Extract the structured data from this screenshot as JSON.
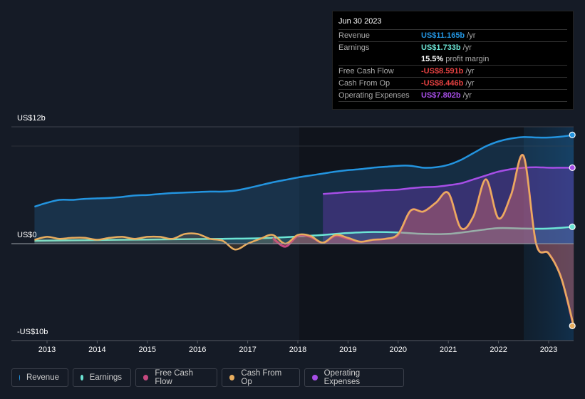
{
  "tooltip": {
    "date": "Jun 30 2023",
    "rows": [
      {
        "label": "Revenue",
        "value": "US$11.165b",
        "unit": "/yr",
        "color": "#2394df"
      },
      {
        "label": "Earnings",
        "value": "US$1.733b",
        "unit": "/yr",
        "color": "#6ce5d5"
      },
      {
        "label": "",
        "value": "15.5%",
        "unit": "profit margin",
        "color": "#ffffff"
      },
      {
        "label": "Free Cash Flow",
        "value": "-US$8.591b",
        "unit": "/yr",
        "color": "#e64141"
      },
      {
        "label": "Cash From Op",
        "value": "-US$8.446b",
        "unit": "/yr",
        "color": "#e64141"
      },
      {
        "label": "Operating Expenses",
        "value": "US$7.802b",
        "unit": "/yr",
        "color": "#a64ee6"
      }
    ]
  },
  "legend": [
    {
      "label": "Revenue",
      "color": "#2394df"
    },
    {
      "label": "Earnings",
      "color": "#6ce5d5"
    },
    {
      "label": "Free Cash Flow",
      "color": "#c4487f"
    },
    {
      "label": "Cash From Op",
      "color": "#e8ad5e"
    },
    {
      "label": "Operating Expenses",
      "color": "#a64ee6"
    }
  ],
  "chart_data": {
    "type": "area",
    "title": "",
    "xlabel": "",
    "ylabel": "",
    "y_ticks": [
      "US$12b",
      "US$0",
      "-US$10b"
    ],
    "x_ticks": [
      "2013",
      "2014",
      "2015",
      "2016",
      "2017",
      "2018",
      "2019",
      "2020",
      "2021",
      "2022",
      "2023"
    ],
    "ylim": [
      -10,
      12
    ],
    "xlim": [
      2012.33,
      2023.5
    ],
    "series": [
      {
        "name": "Revenue",
        "color": "#2394df",
        "x": [
          2012.75,
          2013.0,
          2013.25,
          2013.5,
          2013.75,
          2014.0,
          2014.25,
          2014.5,
          2014.75,
          2015.0,
          2015.25,
          2015.5,
          2015.75,
          2016.0,
          2016.25,
          2016.5,
          2016.75,
          2017.0,
          2017.25,
          2017.5,
          2017.75,
          2018.0,
          2018.25,
          2018.5,
          2018.75,
          2019.0,
          2019.25,
          2019.5,
          2019.75,
          2020.0,
          2020.25,
          2020.5,
          2020.75,
          2021.0,
          2021.25,
          2021.5,
          2021.75,
          2022.0,
          2022.25,
          2022.5,
          2022.75,
          2023.0,
          2023.25,
          2023.5
        ],
        "values": [
          3.8,
          4.2,
          4.5,
          4.5,
          4.6,
          4.65,
          4.7,
          4.8,
          4.95,
          5.0,
          5.1,
          5.2,
          5.25,
          5.3,
          5.35,
          5.35,
          5.45,
          5.7,
          6.0,
          6.3,
          6.55,
          6.8,
          7.0,
          7.2,
          7.4,
          7.55,
          7.65,
          7.8,
          7.9,
          8.0,
          8.0,
          7.8,
          7.85,
          8.1,
          8.6,
          9.3,
          10.0,
          10.5,
          10.8,
          10.95,
          10.9,
          10.9,
          11.0,
          11.165
        ]
      },
      {
        "name": "Earnings",
        "color": "#6ce5d5",
        "x": [
          2012.75,
          2013.5,
          2014.5,
          2015.5,
          2016.5,
          2017.5,
          2018.5,
          2019.0,
          2019.5,
          2020.0,
          2020.5,
          2021.0,
          2021.5,
          2022.0,
          2022.5,
          2023.0,
          2023.5
        ],
        "values": [
          0.3,
          0.35,
          0.4,
          0.45,
          0.5,
          0.6,
          0.9,
          1.1,
          1.2,
          1.15,
          1.0,
          1.0,
          1.3,
          1.6,
          1.55,
          1.55,
          1.733
        ]
      },
      {
        "name": "Free Cash Flow",
        "color": "#c4487f",
        "x": [
          2017.5,
          2017.75,
          2018.0,
          2018.25,
          2018.5,
          2018.75,
          2019.0,
          2019.25,
          2019.5,
          2019.75,
          2020.0,
          2020.25,
          2020.5,
          2020.75,
          2021.0,
          2021.25,
          2021.5,
          2021.75,
          2022.0,
          2022.25,
          2022.5,
          2022.75,
          2023.0,
          2023.25,
          2023.5
        ],
        "values": [
          0.6,
          -0.3,
          0.8,
          0.7,
          0.1,
          0.8,
          0.5,
          0.2,
          0.4,
          0.5,
          0.9,
          3.4,
          3.3,
          4.2,
          5.2,
          1.6,
          2.8,
          6.6,
          2.6,
          5.0,
          9.0,
          0.0,
          -1.0,
          -3.5,
          -8.591
        ]
      },
      {
        "name": "Cash From Op",
        "color": "#e8ad5e",
        "x": [
          2012.75,
          2013.0,
          2013.25,
          2013.5,
          2013.75,
          2014.0,
          2014.25,
          2014.5,
          2014.75,
          2015.0,
          2015.25,
          2015.5,
          2015.75,
          2016.0,
          2016.25,
          2016.5,
          2016.75,
          2017.0,
          2017.25,
          2017.5,
          2017.75,
          2018.0,
          2018.25,
          2018.5,
          2018.75,
          2019.0,
          2019.25,
          2019.5,
          2019.75,
          2020.0,
          2020.25,
          2020.5,
          2020.75,
          2021.0,
          2021.25,
          2021.5,
          2021.75,
          2022.0,
          2022.25,
          2022.5,
          2022.75,
          2023.0,
          2023.25,
          2023.5
        ],
        "values": [
          0.4,
          0.7,
          0.5,
          0.6,
          0.6,
          0.4,
          0.6,
          0.7,
          0.5,
          0.7,
          0.7,
          0.5,
          1.0,
          1.0,
          0.5,
          0.3,
          -0.6,
          0.0,
          0.5,
          0.9,
          0.0,
          0.9,
          0.8,
          0.1,
          0.9,
          0.6,
          0.2,
          0.4,
          0.5,
          1.0,
          3.4,
          3.3,
          4.2,
          5.2,
          1.6,
          2.8,
          6.6,
          2.6,
          5.0,
          9.0,
          0.0,
          -1.0,
          -3.5,
          -8.446
        ]
      },
      {
        "name": "Operating Expenses",
        "color": "#a64ee6",
        "x": [
          2018.5,
          2018.75,
          2019.0,
          2019.25,
          2019.5,
          2019.75,
          2020.0,
          2020.25,
          2020.5,
          2020.75,
          2021.0,
          2021.25,
          2021.5,
          2021.75,
          2022.0,
          2022.25,
          2022.5,
          2022.75,
          2023.0,
          2023.25,
          2023.5
        ],
        "values": [
          5.1,
          5.2,
          5.3,
          5.35,
          5.4,
          5.5,
          5.55,
          5.7,
          5.8,
          5.85,
          6.0,
          6.2,
          6.6,
          7.0,
          7.4,
          7.65,
          7.8,
          7.85,
          7.8,
          7.8,
          7.802
        ]
      }
    ],
    "highlight_period_start": 2022.5,
    "legend_position": "bottom-left",
    "grid": true
  }
}
